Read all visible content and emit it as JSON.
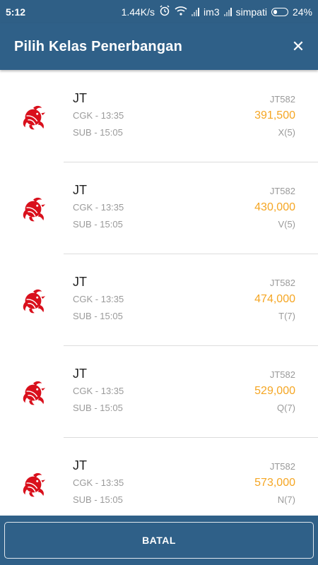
{
  "status_bar": {
    "time": "5:12",
    "speed": "1.44K/s",
    "carrier1": "im3",
    "carrier2": "simpati",
    "battery": "24%",
    "icons": [
      "alarm-icon",
      "wifi-icon",
      "signal-icon",
      "signal-icon",
      "battery-icon"
    ]
  },
  "header": {
    "title": "Pilih Kelas Penerbangan",
    "close_icon": "close-icon"
  },
  "colors": {
    "primary": "#2f6088",
    "price": "#f5a623",
    "airline_logo": "#d9101c"
  },
  "flights": [
    {
      "airline": "JT",
      "departure": "CGK - 13:35",
      "arrival": "SUB - 15:05",
      "flight_no": "JT582",
      "price": "391,500",
      "class": "X(5)"
    },
    {
      "airline": "JT",
      "departure": "CGK - 13:35",
      "arrival": "SUB - 15:05",
      "flight_no": "JT582",
      "price": "430,000",
      "class": "V(5)"
    },
    {
      "airline": "JT",
      "departure": "CGK - 13:35",
      "arrival": "SUB - 15:05",
      "flight_no": "JT582",
      "price": "474,000",
      "class": "T(7)"
    },
    {
      "airline": "JT",
      "departure": "CGK - 13:35",
      "arrival": "SUB - 15:05",
      "flight_no": "JT582",
      "price": "529,000",
      "class": "Q(7)"
    },
    {
      "airline": "JT",
      "departure": "CGK - 13:35",
      "arrival": "SUB - 15:05",
      "flight_no": "JT582",
      "price": "573,000",
      "class": "N(7)"
    }
  ],
  "footer": {
    "cancel_label": "BATAL"
  }
}
